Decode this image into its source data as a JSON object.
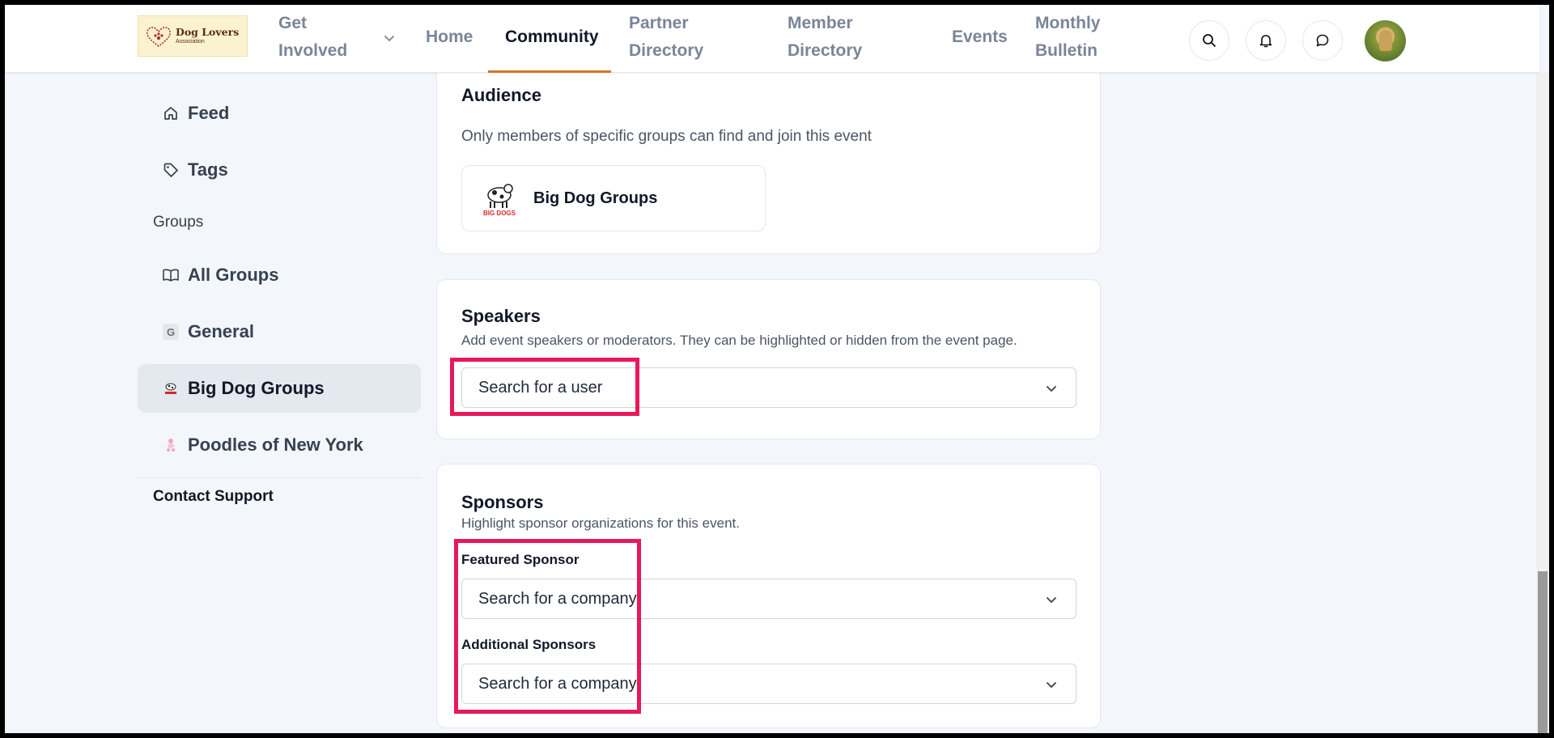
{
  "brand": {
    "logo_line1": "Dog Lovers",
    "logo_line2": "Association"
  },
  "nav": {
    "items": [
      {
        "label_l1": "Get",
        "label_l2": "Involved"
      },
      {
        "label": "Home"
      },
      {
        "label": "Community"
      },
      {
        "label_l1": "Partner",
        "label_l2": "Directory"
      },
      {
        "label_l1": "Member",
        "label_l2": "Directory"
      },
      {
        "label": "Events"
      },
      {
        "label_l1": "Monthly",
        "label_l2": "Bulletin"
      }
    ],
    "active": "Community",
    "accent_color": "#d97324",
    "icons": [
      "search-icon",
      "bell-icon",
      "chat-bubble-icon"
    ]
  },
  "sidebar": {
    "feed": "Feed",
    "tags": "Tags",
    "groups_heading": "Groups",
    "all_groups": "All Groups",
    "general": "General",
    "general_badge": "G",
    "big_dog_groups": "Big Dog Groups",
    "poodles": "Poodles of New York",
    "contact_support": "Contact Support"
  },
  "audience": {
    "title": "Audience",
    "description": "Only members of specific groups can find and join this event",
    "group_name": "Big Dog Groups",
    "group_logo_text": "BIG DOGS"
  },
  "speakers": {
    "title": "Speakers",
    "description": "Add event speakers or moderators. They can be highlighted or hidden from the event page.",
    "placeholder": "Search for a user"
  },
  "sponsors": {
    "title": "Sponsors",
    "description": "Highlight sponsor organizations for this event.",
    "featured_label": "Featured Sponsor",
    "featured_placeholder": "Search for a company",
    "additional_label": "Additional Sponsors",
    "additional_placeholder": "Search for a company"
  },
  "highlight_color": "#e8195a"
}
